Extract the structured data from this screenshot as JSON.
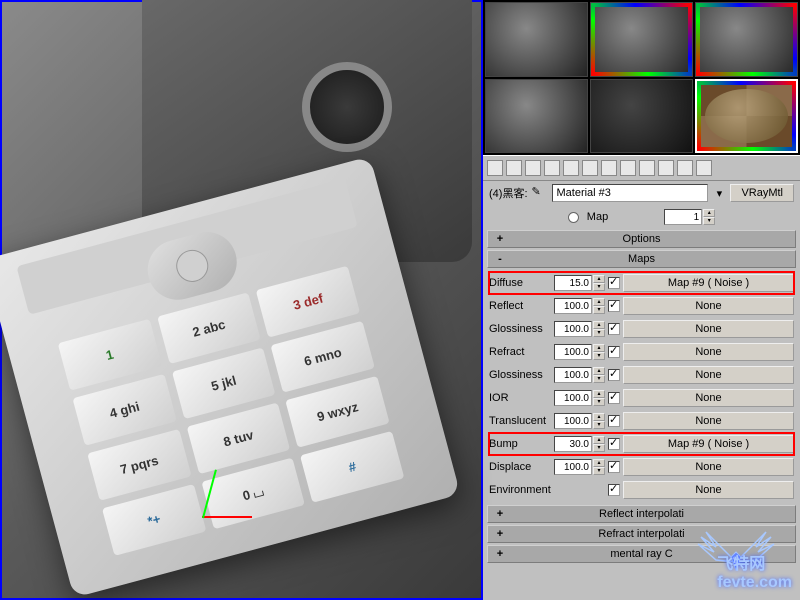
{
  "material": {
    "slot_label": "(4)黑客:",
    "name": "Material #3",
    "type_button": "VRayMtl",
    "basic_radio": "Map",
    "basic_spinner": "1"
  },
  "rollouts": {
    "options": {
      "sign": "+",
      "title": "Options"
    },
    "maps": {
      "sign": "-",
      "title": "Maps"
    },
    "reflect_interp": {
      "sign": "+",
      "title": "Reflect interpolati"
    },
    "refract_interp": {
      "sign": "+",
      "title": "Refract interpolati"
    },
    "mental_ray": {
      "sign": "+",
      "title": "mental ray C"
    }
  },
  "maps": [
    {
      "label": "Diffuse",
      "amount": "15.0",
      "checked": true,
      "map": "Map #9  ( Noise )",
      "highlight": true
    },
    {
      "label": "Reflect",
      "amount": "100.0",
      "checked": true,
      "map": "None",
      "highlight": false
    },
    {
      "label": "Glossiness",
      "amount": "100.0",
      "checked": true,
      "map": "None",
      "highlight": false
    },
    {
      "label": "Refract",
      "amount": "100.0",
      "checked": true,
      "map": "None",
      "highlight": false
    },
    {
      "label": "Glossiness",
      "amount": "100.0",
      "checked": true,
      "map": "None",
      "highlight": false
    },
    {
      "label": "IOR",
      "amount": "100.0",
      "checked": true,
      "map": "None",
      "highlight": false
    },
    {
      "label": "Translucent",
      "amount": "100.0",
      "checked": true,
      "map": "None",
      "highlight": false
    },
    {
      "label": "Bump",
      "amount": "30.0",
      "checked": true,
      "map": "Map #9  ( Noise )",
      "highlight": true
    },
    {
      "label": "Displace",
      "amount": "100.0",
      "checked": true,
      "map": "None",
      "highlight": false
    },
    {
      "label": "Environment",
      "amount": "",
      "checked": true,
      "map": "None",
      "highlight": false
    }
  ],
  "keypad": [
    [
      "1",
      "2 abc",
      "3 def"
    ],
    [
      "4 ghi",
      "5 jkl",
      "6 mno"
    ],
    [
      "7 pqrs",
      "8 tuv",
      "9 wxyz"
    ],
    [
      "*+",
      "0 ⌴",
      "#"
    ]
  ],
  "watermark": "fevte.com",
  "watermark_cn": "飞特网"
}
